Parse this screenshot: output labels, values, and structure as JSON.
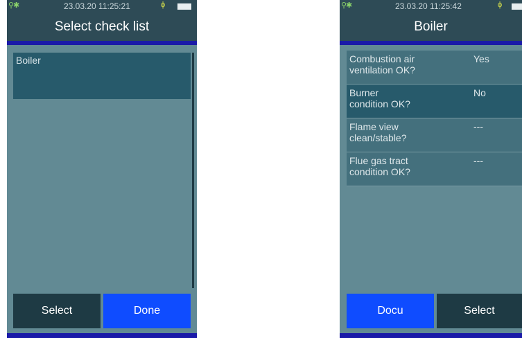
{
  "left_screen": {
    "status": {
      "datetime": "23.03.20 11:25:21"
    },
    "title": "Select check list",
    "list_items": [
      {
        "label": "Boiler"
      }
    ],
    "buttons": {
      "select": "Select",
      "done": "Done"
    }
  },
  "right_screen": {
    "status": {
      "datetime": "23.03.20 11:25:42"
    },
    "title": "Boiler",
    "checklist": [
      {
        "question_line1": "Combustion air",
        "question_line2": "ventilation OK?",
        "answer": "Yes"
      },
      {
        "question_line1": "Burner",
        "question_line2": "condition OK?",
        "answer": "No"
      },
      {
        "question_line1": "Flame view",
        "question_line2": "clean/stable?",
        "answer": "---"
      },
      {
        "question_line1": "Flue gas tract",
        "question_line2": "condition OK?",
        "answer": "---"
      }
    ],
    "buttons": {
      "docu": "Docu",
      "select": "Select"
    }
  },
  "colors": {
    "status_bar": "#2e4b56",
    "screen_bg": "#628a94",
    "selected_row": "#275a6b",
    "accent_blue": "#0f4cff",
    "button_dark": "#1e3a44"
  },
  "icons": [
    "usb-plug-icon",
    "bluetooth-icon",
    "battery-icon"
  ]
}
